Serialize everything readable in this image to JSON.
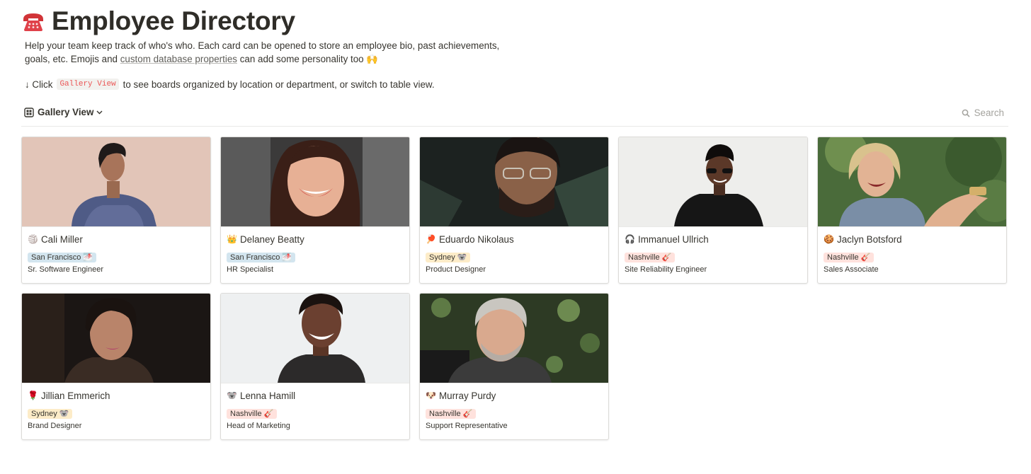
{
  "page": {
    "icon": "telephone-icon",
    "title": "Employee Directory",
    "description_1": "Help your team keep track of who's who. Each card can be opened to store an employee bio, past achievements, goals, etc. Emojis and ",
    "description_link": "custom database properties",
    "description_2": " can add some personality too 🙌",
    "hint_arrow": "↓ Click",
    "hint_code": "Gallery View",
    "hint_rest": "to see boards organized by location or department, or switch to table view."
  },
  "toolbar": {
    "view_label": "Gallery View",
    "search_label": "Search"
  },
  "colors": {
    "tag_san_francisco": "#d3e5ef",
    "tag_sydney": "#fdecc8",
    "tag_nashville": "#ffe2dd",
    "code_text": "#eb5757"
  },
  "cards": [
    {
      "emoji": "🏐",
      "name": "Cali Miller",
      "location": "San Francisco 🌁",
      "role": "Sr. Software Engineer"
    },
    {
      "emoji": "👑",
      "name": "Delaney Beatty",
      "location": "San Francisco 🌁",
      "role": "HR Specialist"
    },
    {
      "emoji": "🏓",
      "name": "Eduardo Nikolaus",
      "location": "Sydney 🐨",
      "role": "Product Designer"
    },
    {
      "emoji": "🎧",
      "name": "Immanuel Ullrich",
      "location": "Nashville 🎸",
      "role": "Site Reliability Engineer"
    },
    {
      "emoji": "🍪",
      "name": "Jaclyn Botsford",
      "location": "Nashville 🎸",
      "role": "Sales Associate"
    },
    {
      "emoji": "🌹",
      "name": "Jillian Emmerich",
      "location": "Sydney 🐨",
      "role": "Brand Designer"
    },
    {
      "emoji": "🐨",
      "name": "Lenna Hamill",
      "location": "Nashville 🎸",
      "role": "Head of Marketing"
    },
    {
      "emoji": "🐶",
      "name": "Murray Purdy",
      "location": "Nashville 🎸",
      "role": "Support Representative"
    }
  ]
}
